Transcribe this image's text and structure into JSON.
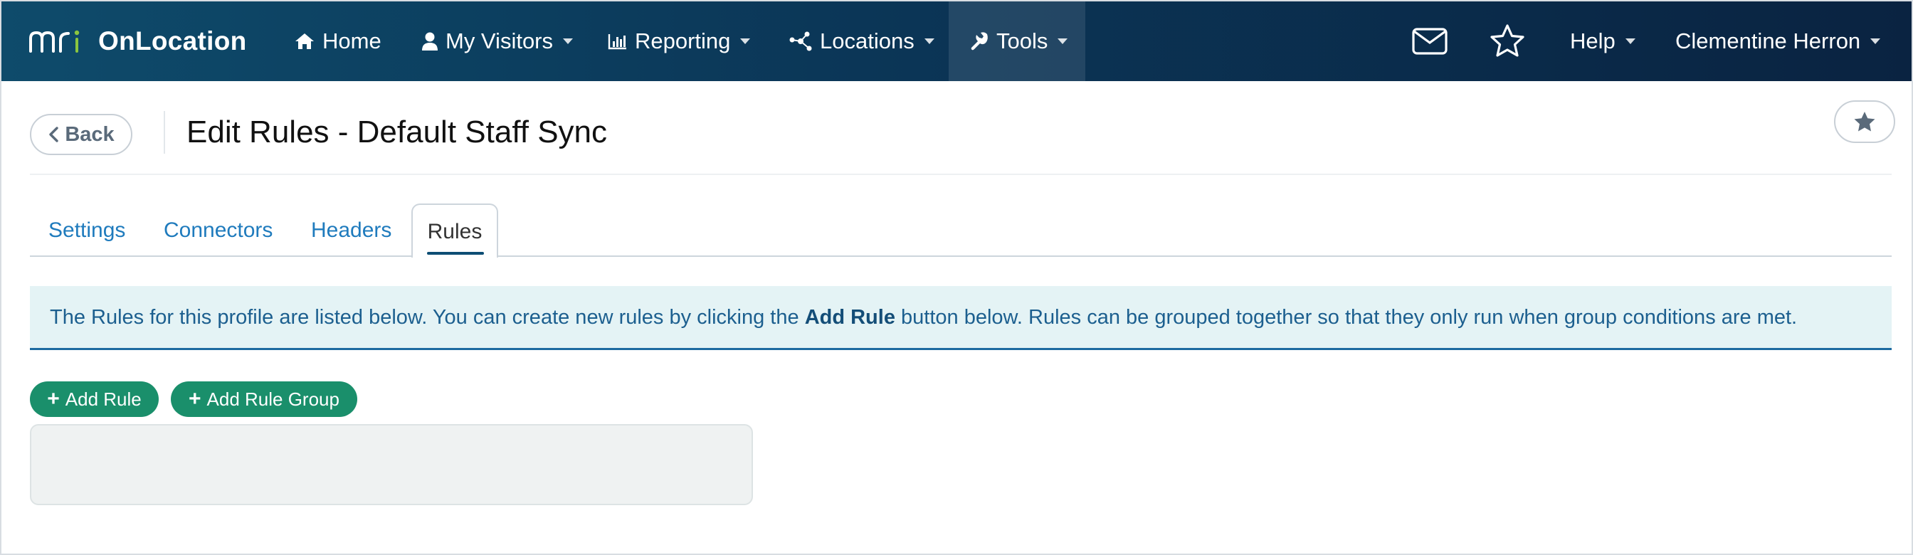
{
  "app": {
    "name": "OnLocation",
    "accent": "#1a8f6b",
    "nav_gradient": [
      "#0e4b6b",
      "#0a2341"
    ]
  },
  "nav": {
    "items": [
      {
        "label": "Home",
        "icon": "home-icon"
      },
      {
        "label": "My Visitors",
        "icon": "user-icon",
        "dropdown": true
      },
      {
        "label": "Reporting",
        "icon": "bar-chart-icon",
        "dropdown": true
      },
      {
        "label": "Locations",
        "icon": "network-icon",
        "dropdown": true
      },
      {
        "label": "Tools",
        "icon": "wrench-icon",
        "dropdown": true,
        "active": true
      }
    ],
    "right": {
      "help_label": "Help",
      "user_label": "Clementine Herron"
    }
  },
  "page": {
    "back_label": "Back",
    "title": "Edit Rules - Default Staff Sync"
  },
  "tabs": [
    {
      "label": "Settings"
    },
    {
      "label": "Connectors"
    },
    {
      "label": "Headers"
    },
    {
      "label": "Rules",
      "active": true
    }
  ],
  "info": {
    "text_before": "The Rules for this profile are listed below. You can create new rules by clicking the ",
    "bold": "Add Rule",
    "text_after": " button below. Rules can be grouped together so that they only run when group conditions are met."
  },
  "actions": {
    "add_rule_label": "Add Rule",
    "add_rule_group_label": "Add Rule Group"
  }
}
